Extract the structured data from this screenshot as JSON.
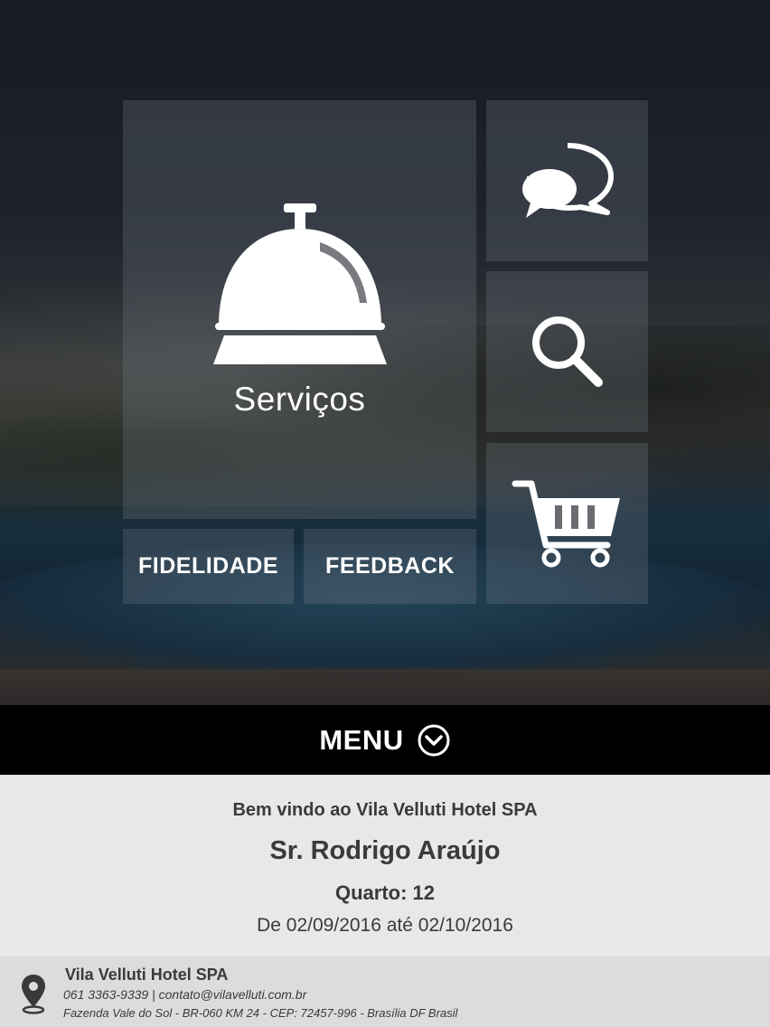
{
  "tiles": {
    "services_label": "Serviços",
    "fidelity_label": "FIDELIDADE",
    "feedback_label": "FEEDBACK",
    "chat_icon": "chat-bubbles-icon",
    "search_icon": "search-icon",
    "cart_icon": "shopping-cart-icon",
    "services_icon": "service-bell-icon"
  },
  "menu": {
    "label": "MENU",
    "icon": "chevron-down-circle-icon"
  },
  "welcome": {
    "greeting": "Bem vindo ao Vila Velluti Hotel SPA",
    "guest_name": "Sr. Rodrigo Araújo",
    "room": "Quarto: 12",
    "stay_dates": "De 02/09/2016 até 02/10/2016"
  },
  "footer": {
    "hotel_name": "Vila Velluti Hotel SPA",
    "contact": "061 3363-9339 | contato@vilavelluti.com.br",
    "address": "Fazenda Vale do Sol - BR-060 KM 24  - CEP: 72457-996 - Brasília DF Brasil",
    "icon": "location-pin-icon"
  },
  "colors": {
    "menu_bar": "#000000",
    "welcome_bg": "#e8e8ea",
    "footer_bg": "#dcdcde",
    "text_dark": "#3a3a3c"
  }
}
